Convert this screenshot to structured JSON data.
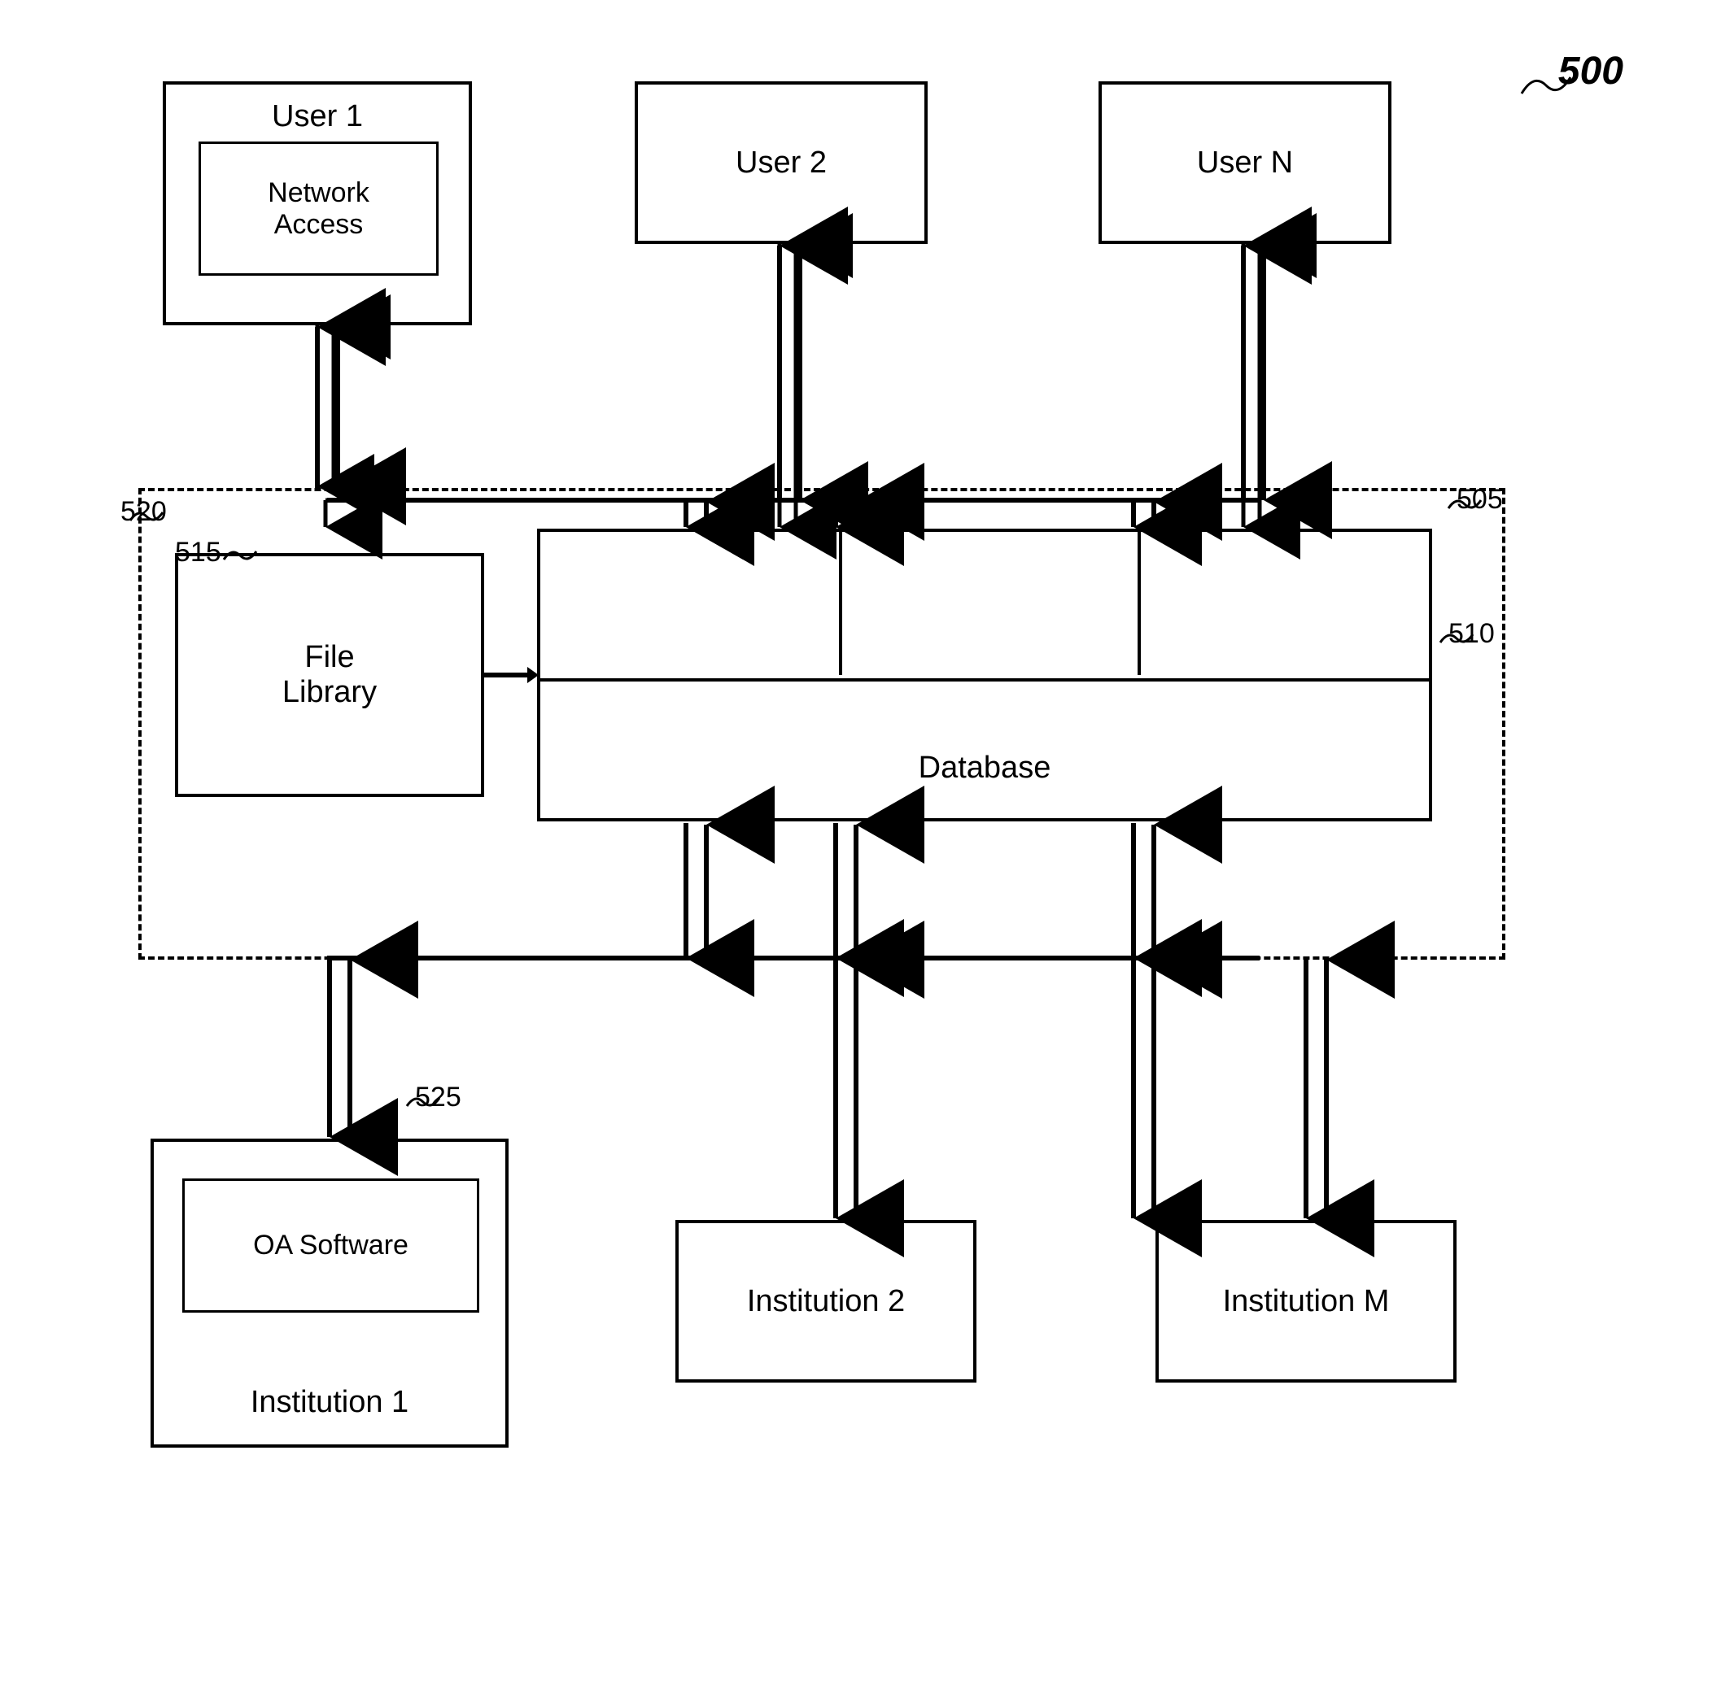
{
  "figure": {
    "number": "500",
    "labels": {
      "user1": "User 1",
      "user1_inner": "Network\nAccess",
      "user2": "User 2",
      "userN": "User N",
      "fileLibrary": "File\nLibrary",
      "database": "Database",
      "institution1_outer": "Institution 1",
      "institution1_inner": "OA Software",
      "institution2": "Institution 2",
      "institutionM": "Institution M",
      "ref_500": "500",
      "ref_520": "520",
      "ref_505": "505",
      "ref_515": "515",
      "ref_510": "510",
      "ref_525": "525"
    }
  }
}
